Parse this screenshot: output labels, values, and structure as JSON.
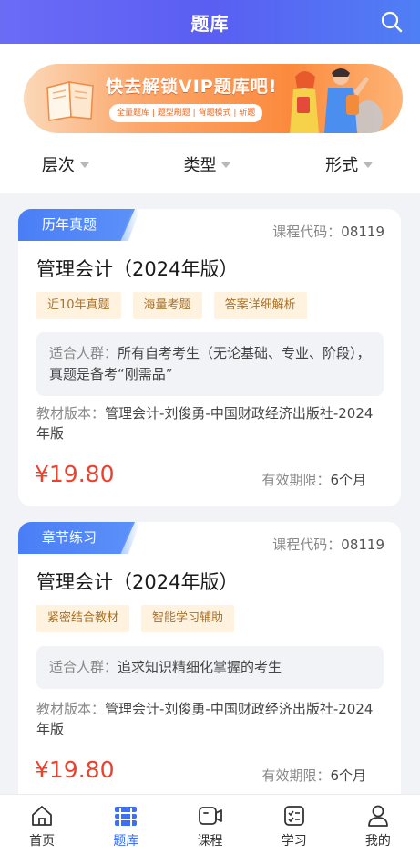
{
  "header": {
    "title": "题库",
    "search_icon": "search-icon"
  },
  "banner": {
    "headline": "快去解锁VIP题库吧!",
    "tagline": "全量题库 | 题型刷题 | 背题模式 | 斩题"
  },
  "filters": [
    {
      "label": "层次"
    },
    {
      "label": "类型"
    },
    {
      "label": "形式"
    }
  ],
  "cards": [
    {
      "ribbon": "历年真题",
      "code_label": "课程代码：",
      "code": "08119",
      "title": "管理会计（2024年版）",
      "tags": [
        "近10年真题",
        "海量考题",
        "答案详细解析"
      ],
      "audience_label": "适合人群：",
      "audience": "所有自考考生（无论基础、专业、阶段），真题是备考“刚需品”",
      "edition_label": "教材版本：",
      "edition": "管理会计-刘俊勇-中国财政经济出版社-2024年版",
      "price": "¥19.80",
      "validity_label": "有效期限：",
      "validity": "6个月"
    },
    {
      "ribbon": "章节练习",
      "code_label": "课程代码：",
      "code": "08119",
      "title": "管理会计（2024年版）",
      "tags": [
        "紧密结合教材",
        "智能学习辅助"
      ],
      "audience_label": "适合人群：",
      "audience": "追求知识精细化掌握的考生",
      "edition_label": "教材版本：",
      "edition": "管理会计-刘俊勇-中国财政经济出版社-2024年版",
      "price": "¥19.80",
      "validity_label": "有效期限：",
      "validity": "6个月"
    }
  ],
  "tabbar": [
    {
      "label": "首页",
      "icon": "home-icon"
    },
    {
      "label": "题库",
      "icon": "question-bank-icon",
      "active": true
    },
    {
      "label": "课程",
      "icon": "video-icon"
    },
    {
      "label": "学习",
      "icon": "checklist-icon"
    },
    {
      "label": "我的",
      "icon": "user-icon"
    }
  ],
  "colors": {
    "accent": "#3d6ef5",
    "price": "#f0402c",
    "header_start": "#6b6cf6",
    "header_end": "#4f7ff5"
  }
}
